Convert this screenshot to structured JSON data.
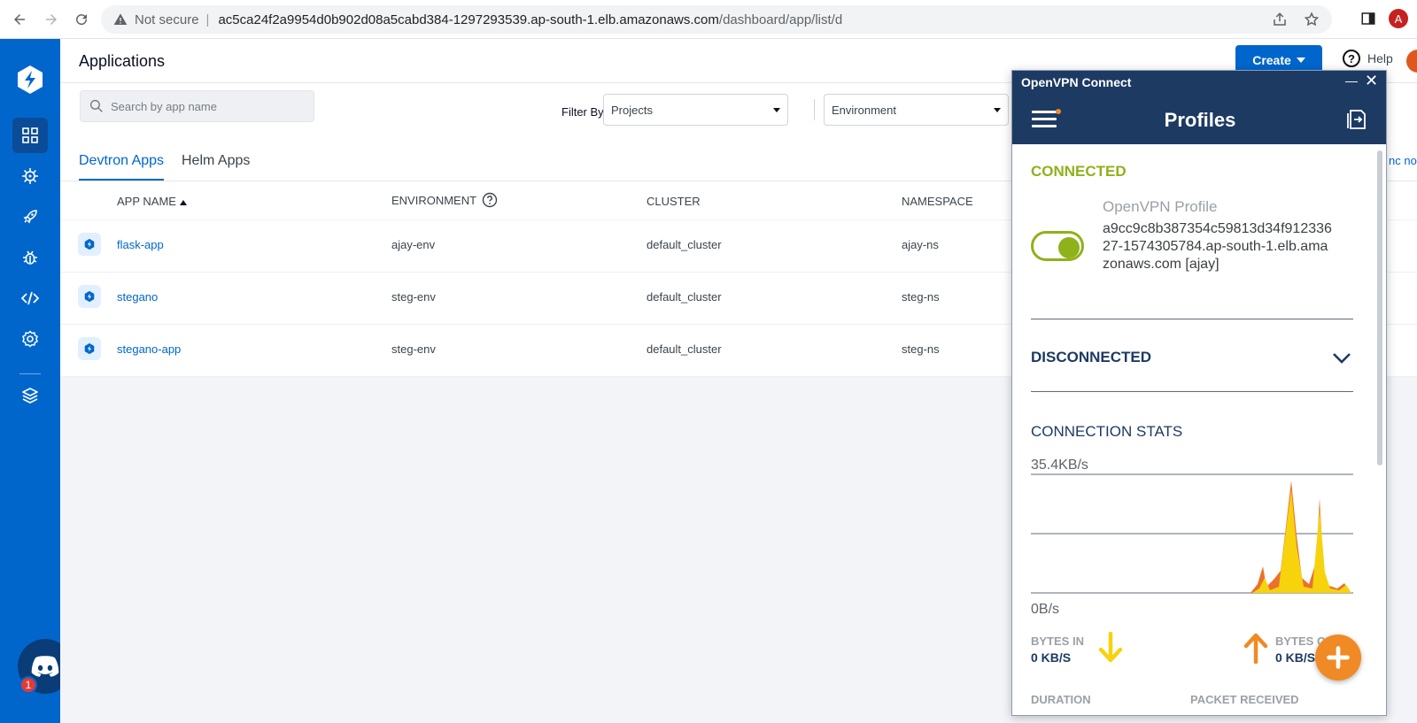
{
  "browser": {
    "security": "Not secure",
    "separator": "|",
    "url_host": "ac5ca24f2a9954d0b902d08a5cabd384-1297293539.ap-south-1.elb.amazonaws.com",
    "url_path": "/dashboard/app/list/d",
    "profile_initial": "A"
  },
  "header": {
    "title": "Applications",
    "create_label": "Create",
    "help_label": "Help"
  },
  "search": {
    "placeholder": "Search by app name"
  },
  "filters": {
    "label": "Filter By",
    "projects": "Projects",
    "environment": "Environment"
  },
  "tabs": [
    {
      "label": "Devtron Apps",
      "active": true
    },
    {
      "label": "Helm Apps",
      "active": false
    }
  ],
  "overflow_text": "nc no",
  "table": {
    "columns": [
      "APP NAME",
      "ENVIRONMENT",
      "CLUSTER",
      "NAMESPACE"
    ],
    "rows": [
      {
        "app": "flask-app",
        "env": "ajay-env",
        "cluster": "default_cluster",
        "namespace": "ajay-ns"
      },
      {
        "app": "stegano",
        "env": "steg-env",
        "cluster": "default_cluster",
        "namespace": "steg-ns"
      },
      {
        "app": "stegano-app",
        "env": "steg-env",
        "cluster": "default_cluster",
        "namespace": "steg-ns"
      }
    ]
  },
  "discord": {
    "badge": "1"
  },
  "vpn": {
    "window_title": "OpenVPN Connect",
    "header_title": "Profiles",
    "connected_label": "CONNECTED",
    "profile_name": "OpenVPN Profile",
    "profile_host": "a9cc9c8b387354c59813d34f91233627-1574305784.ap-south-1.elb.amazonaws.com [ajay]",
    "disconnected_label": "DISCONNECTED",
    "stats_label": "CONNECTION STATS",
    "rate_top": "35.4KB/s",
    "rate_bottom": "0B/s",
    "bytes_in_label": "BYTES IN",
    "bytes_in_value": "0 KB/S",
    "bytes_out_label": "BYTES OUT",
    "bytes_out_value": "0 KB/S",
    "duration_label": "DURATION",
    "packet_label": "PACKET RECEIVED",
    "colors": {
      "dark_blue": "#1d3a63",
      "green": "#8fb11a",
      "orange": "#f08a24",
      "yellow": "#f6d30d"
    }
  }
}
